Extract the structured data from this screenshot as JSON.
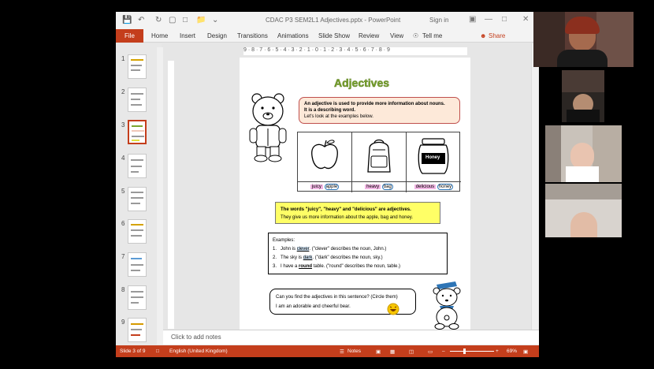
{
  "window": {
    "title": "CDAC P3 SEM2L1 Adjectives.pptx - PowerPoint",
    "signin": "Sign in"
  },
  "ribbon": {
    "tabs": [
      "File",
      "Home",
      "Insert",
      "Design",
      "Transitions",
      "Animations",
      "Slide Show",
      "Review",
      "View"
    ],
    "tell_me": "Tell me",
    "share": "Share"
  },
  "thumbnails": {
    "numbers": [
      "1",
      "2",
      "3",
      "4",
      "5",
      "6",
      "7",
      "8",
      "9"
    ],
    "active_index": 3
  },
  "ruler": {
    "top_ticks": "9 · 8 · 7 · 6 · 5 · 4 · 3 · 2 · 1 · 0 · 1 · 2 · 3 · 4 · 5 · 6 · 7 · 8 · 9"
  },
  "slide": {
    "title": "Adjectives",
    "bubble1": {
      "line1": "An adjective is used to provide more information about nouns.",
      "line2": "It is a describing word.",
      "line3": "Let's look at the examples below."
    },
    "pictures": [
      {
        "adj": "juicy",
        "noun": "apple"
      },
      {
        "adj": "heavy",
        "noun": "bag"
      },
      {
        "adj": "delicious",
        "noun": "honey"
      }
    ],
    "honey_label": "Honey",
    "yellow": {
      "line1": "The words \"juicy\", \"heavy\" and \"delicious\" are adjectives.",
      "line2": "They give us more information about the apple, bag and honey."
    },
    "examples": {
      "heading": "Examples:",
      "items": [
        {
          "num": "1.",
          "pre": "John is ",
          "word": "clever",
          "post": ". (\"clever\" describes the noun, John.)"
        },
        {
          "num": "2.",
          "pre": "The sky is ",
          "word": "dark",
          "post": ". (\"dark\" describes the noun, sky.)"
        },
        {
          "num": "3.",
          "pre": "I have a ",
          "word": "round",
          "post": " table. (\"round\" describes the noun, table.)"
        }
      ]
    },
    "bubble2": {
      "line1": "Can you find the adjectives in this sentence? (Circle them)",
      "line2": "I am an adorable and cheerful bear."
    }
  },
  "notes": {
    "placeholder": "Click to add notes"
  },
  "status": {
    "slide": "Slide 3 of 9",
    "language": "English (United Kingdom)",
    "notes_label": "Notes",
    "zoom": "69%"
  },
  "colors": {
    "accent": "#c43e1c",
    "title_green": "#7ba532"
  }
}
